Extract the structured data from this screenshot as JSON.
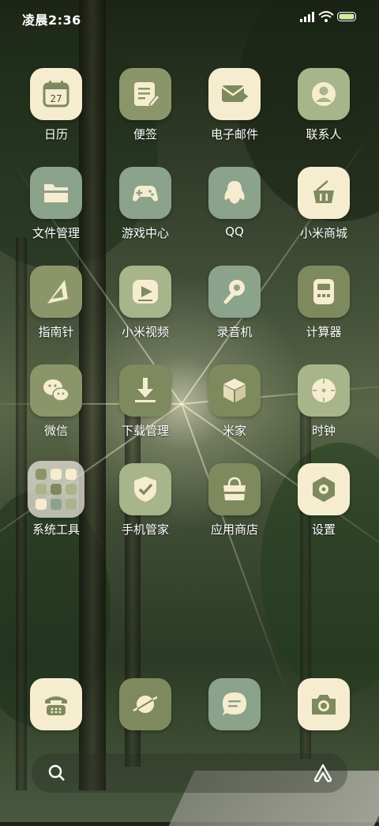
{
  "status_bar": {
    "time": "凌晨2:36"
  },
  "colors": {
    "cream": "#F6EDD0",
    "sage": "#A8B48A",
    "olive": "#7E8A5E",
    "mint": "#8AA38A"
  },
  "apps": [
    {
      "label": "日历",
      "icon": "calendar-icon",
      "day": "27"
    },
    {
      "label": "便签",
      "icon": "notes-icon"
    },
    {
      "label": "电子邮件",
      "icon": "mail-icon"
    },
    {
      "label": "联系人",
      "icon": "contacts-icon"
    },
    {
      "label": "文件管理",
      "icon": "folder-icon"
    },
    {
      "label": "游戏中心",
      "icon": "gamepad-icon"
    },
    {
      "label": "QQ",
      "icon": "qq-penguin-icon"
    },
    {
      "label": "小米商城",
      "icon": "shopping-basket-icon"
    },
    {
      "label": "指南针",
      "icon": "compass-icon"
    },
    {
      "label": "小米视频",
      "icon": "video-play-icon"
    },
    {
      "label": "录音机",
      "icon": "microphone-icon"
    },
    {
      "label": "计算器",
      "icon": "calculator-icon"
    },
    {
      "label": "微信",
      "icon": "wechat-icon"
    },
    {
      "label": "下载管理",
      "icon": "download-icon"
    },
    {
      "label": "米家",
      "icon": "cube-icon"
    },
    {
      "label": "时钟",
      "icon": "clock-icon"
    },
    {
      "label": "系统工具",
      "icon": "folder-grid-icon"
    },
    {
      "label": "手机管家",
      "icon": "shield-check-icon"
    },
    {
      "label": "应用商店",
      "icon": "shopping-bag-icon"
    },
    {
      "label": "设置",
      "icon": "gear-icon"
    }
  ],
  "dock": [
    {
      "icon": "phone-icon"
    },
    {
      "icon": "browser-planet-icon"
    },
    {
      "icon": "message-icon"
    },
    {
      "icon": "camera-icon"
    }
  ],
  "search_bar": {
    "left_icon": "search-icon",
    "right_icon": "assistant-icon"
  }
}
